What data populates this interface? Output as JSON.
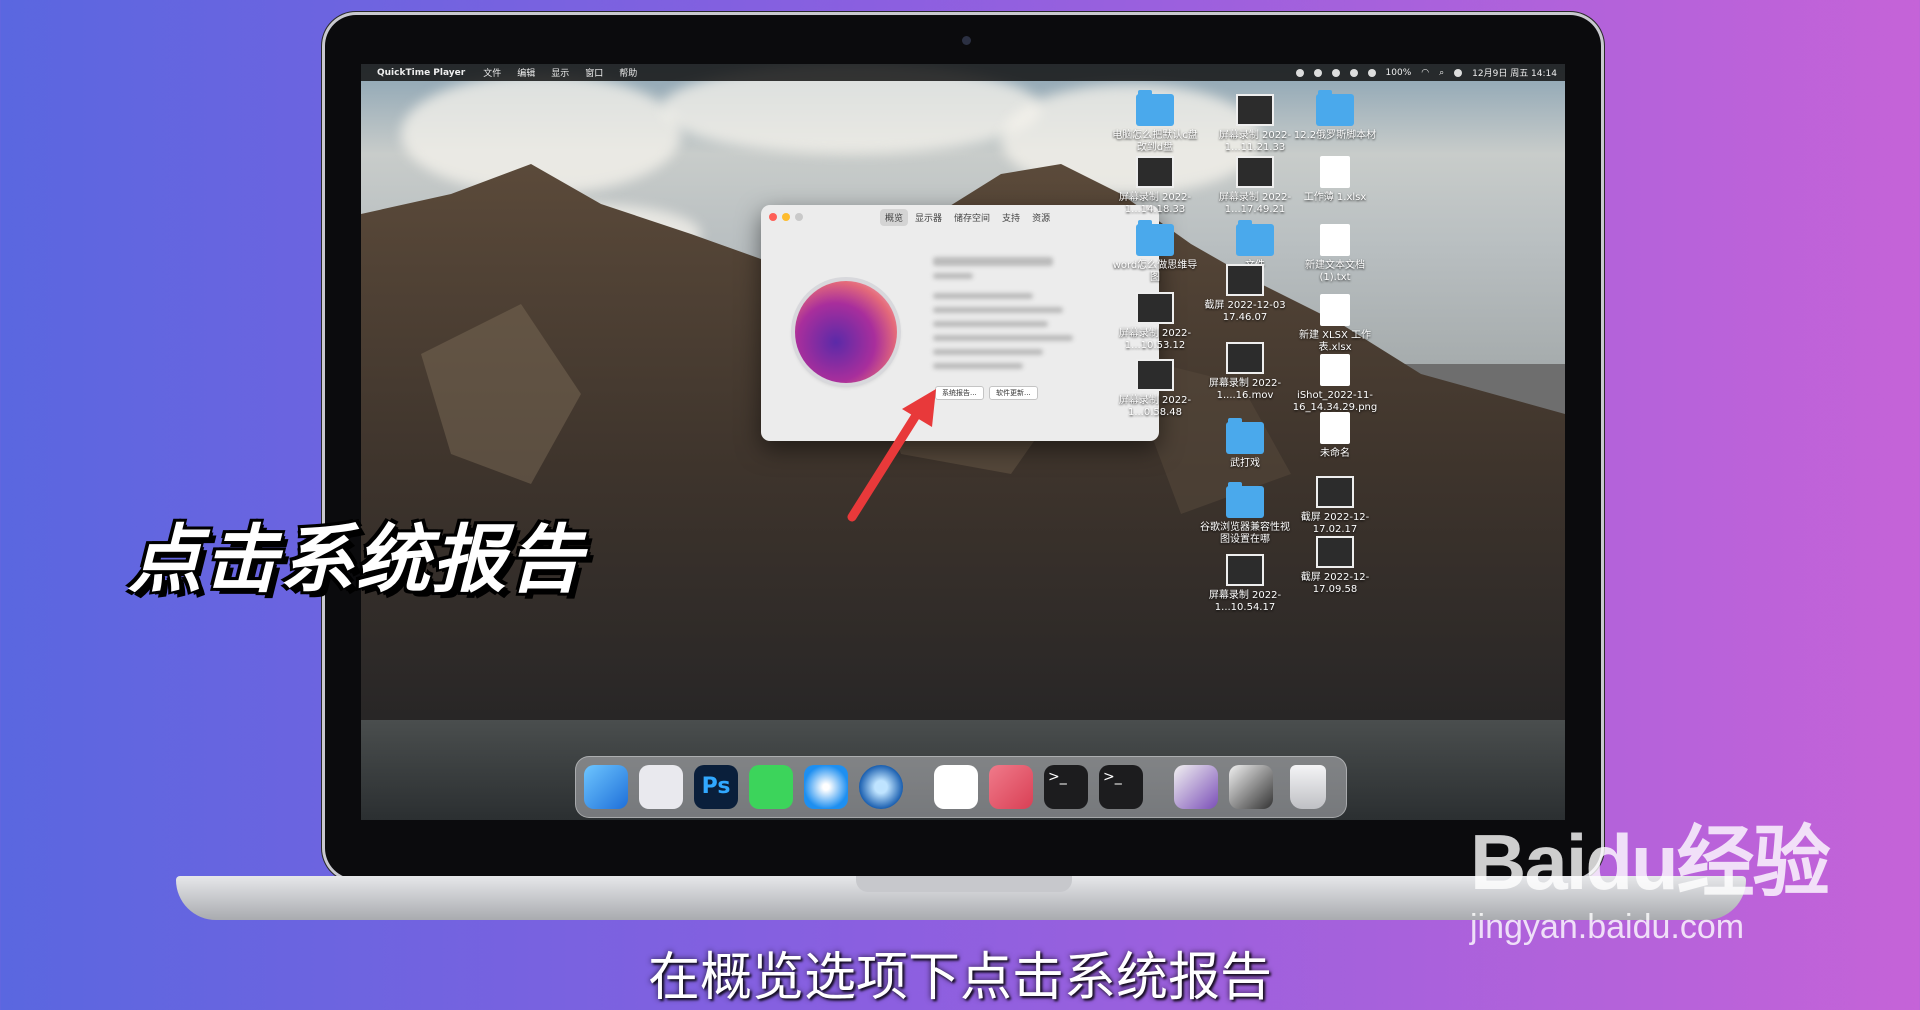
{
  "menubar": {
    "app_name": "QuickTime Player",
    "menus": [
      "文件",
      "编辑",
      "显示",
      "窗口",
      "帮助"
    ],
    "battery": "100%",
    "datetime": "12月9日 周五 14:14"
  },
  "about_window": {
    "tabs": [
      "概览",
      "显示器",
      "储存空间",
      "支持",
      "资源"
    ],
    "active_tab": "概览",
    "system_report_button": "系统报告...",
    "software_update_button": "软件更新..."
  },
  "desktop_items": [
    {
      "label": "电脑怎么把默认c盘改到d盘",
      "kind": "folder"
    },
    {
      "label": "屏幕录制 2022-1...11.21.33",
      "kind": "thumb"
    },
    {
      "label": "12.2俄罗斯脚本材",
      "kind": "folder"
    },
    {
      "label": "屏幕录制 2022-1...14.18.33",
      "kind": "thumb"
    },
    {
      "label": "屏幕录制 2022-1...17.49.21",
      "kind": "thumb"
    },
    {
      "label": "工作薄 1.xlsx",
      "kind": "doc"
    },
    {
      "label": "word怎么做思维导图",
      "kind": "folder"
    },
    {
      "label": "文件",
      "kind": "folder"
    },
    {
      "label": "新建文本文档 (1).txt",
      "kind": "doc"
    },
    {
      "label": "截屏 2022-12-03 17.46.07",
      "kind": "thumb"
    },
    {
      "label": "屏幕录制 2022-1...10.53.12",
      "kind": "thumb"
    },
    {
      "label": "新建 XLSX 工作表.xlsx",
      "kind": "doc"
    },
    {
      "label": "屏幕录制 2022-1....16.mov",
      "kind": "thumb"
    },
    {
      "label": "iShot_2022-11-16_14.34.29.png",
      "kind": "doc"
    },
    {
      "label": "屏幕录制 2022-1...0.58.48",
      "kind": "thumb"
    },
    {
      "label": "武打戏",
      "kind": "folder"
    },
    {
      "label": "未命名",
      "kind": "doc"
    },
    {
      "label": "截屏 2022-12- 17.02.17",
      "kind": "thumb"
    },
    {
      "label": "谷歌浏览器兼容性视图设置在哪",
      "kind": "folder"
    },
    {
      "label": "截屏 2022-12- 17.09.58",
      "kind": "thumb"
    },
    {
      "label": "屏幕录制 2022-1...10.54.17",
      "kind": "thumb"
    }
  ],
  "dock": [
    "Finder",
    "Launchpad",
    "Photoshop",
    "Messages",
    "Safari",
    "QuickTime Player",
    "Feishu",
    "Vectornator",
    "Terminal",
    "Terminal",
    "Photos",
    "Screenshots",
    "Trash"
  ],
  "overlay_title": "点击系统报告",
  "subtitle": "在概览选项下点击系统报告",
  "watermark": {
    "logo": "Baidu经验",
    "url": "jingyan.baidu.com"
  }
}
